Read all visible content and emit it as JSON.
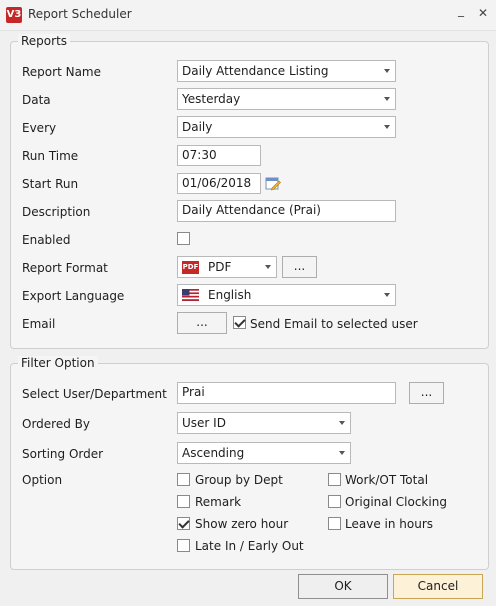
{
  "window": {
    "title": "Report Scheduler",
    "logo_text": "V3",
    "minimize_label": "_",
    "close_label": "✕"
  },
  "reports": {
    "legend": "Reports",
    "report_name": {
      "label": "Report Name",
      "value": "Daily Attendance Listing"
    },
    "data": {
      "label": "Data",
      "value": "Yesterday"
    },
    "every": {
      "label": "Every",
      "value": "Daily"
    },
    "run_time": {
      "label": "Run Time",
      "value": "07:30"
    },
    "start_run": {
      "label": "Start Run",
      "value": "01/06/2018"
    },
    "description": {
      "label": "Description",
      "value": "Daily Attendance (Prai)"
    },
    "enabled": {
      "label": "Enabled",
      "checked": false
    },
    "report_format": {
      "label": "Report Format",
      "value": "PDF",
      "icon": "pdf-icon",
      "icon_text": "PDF",
      "browse_label": "..."
    },
    "export_language": {
      "label": "Export Language",
      "value": "English",
      "icon": "us-flag-icon"
    },
    "email": {
      "label": "Email",
      "browse_label": "...",
      "send_label": "Send Email to selected user",
      "send_checked": true
    }
  },
  "filter": {
    "legend": "Filter Option",
    "select_user": {
      "label": "Select User/Department",
      "value": "Prai",
      "browse_label": "..."
    },
    "ordered_by": {
      "label": "Ordered By",
      "value": "User ID"
    },
    "sorting_order": {
      "label": "Sorting Order",
      "value": "Ascending"
    },
    "option_label": "Option",
    "options": [
      {
        "label": "Group by Dept",
        "checked": false
      },
      {
        "label": "Remark",
        "checked": false
      },
      {
        "label": "Show zero hour",
        "checked": true
      },
      {
        "label": "Late In / Early Out",
        "checked": false
      },
      {
        "label": "Work/OT Total",
        "checked": false
      },
      {
        "label": "Original Clocking",
        "checked": false
      },
      {
        "label": "Leave in hours",
        "checked": false
      }
    ]
  },
  "footer": {
    "ok_label": "OK",
    "cancel_label": "Cancel"
  },
  "colors": {
    "pdf_red": "#c62828",
    "flag_blue": "#3c3b6e",
    "flag_red": "#b22234",
    "cancel_border": "#c9a556"
  }
}
